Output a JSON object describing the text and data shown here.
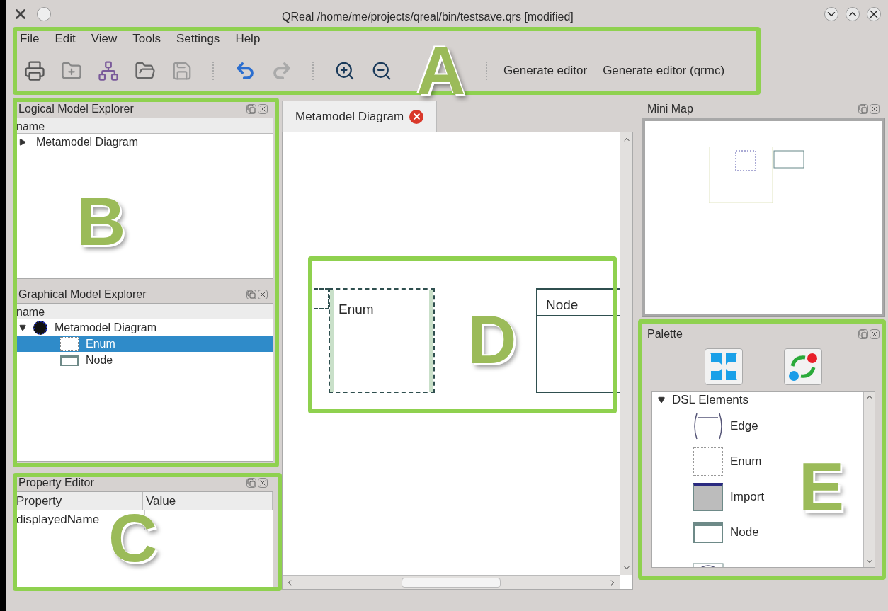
{
  "window": {
    "title": "QReal /home/me/projects/qreal/bin/testsave.qrs [modified]"
  },
  "menu": [
    "File",
    "Edit",
    "View",
    "Tools",
    "Settings",
    "Help"
  ],
  "toolbar": {
    "icons": [
      {
        "kind": "print"
      },
      {
        "kind": "new-folder"
      },
      {
        "kind": "diagram"
      },
      {
        "kind": "open"
      },
      {
        "kind": "save"
      },
      {
        "kind": "sep"
      },
      {
        "kind": "undo"
      },
      {
        "kind": "redo"
      },
      {
        "kind": "sep"
      },
      {
        "kind": "zoom-in"
      },
      {
        "kind": "zoom-out"
      }
    ],
    "actions": [
      "Generate editor",
      "Generate editor (qrmc)"
    ]
  },
  "logical_explorer": {
    "title": "Logical Model Explorer",
    "header": "name",
    "items": [
      {
        "label": "Metamodel Diagram",
        "expanded": false,
        "selected": false
      }
    ]
  },
  "graphical_explorer": {
    "title": "Graphical Model Explorer",
    "header": "name",
    "items": [
      {
        "label": "Metamodel Diagram",
        "expanded": true,
        "selected": false,
        "kind": "diagram",
        "children": [
          {
            "label": "Enum",
            "selected": true,
            "kind": "enum"
          },
          {
            "label": "Node",
            "selected": false,
            "kind": "node"
          }
        ]
      }
    ]
  },
  "property_editor": {
    "title": "Property Editor",
    "columns": [
      "Property",
      "Value"
    ],
    "rows": [
      {
        "property": "displayedName"
      }
    ]
  },
  "tabs": [
    {
      "label": "Metamodel Diagram",
      "selected": true
    }
  ],
  "canvas": {
    "nodes": [
      {
        "kind": "enum",
        "label": "Enum",
        "selected": true
      },
      {
        "kind": "node",
        "label": "Node",
        "selected": false
      }
    ]
  },
  "mini_map": {
    "title": "Mini Map"
  },
  "palette": {
    "title": "Palette",
    "group": {
      "label": "DSL Elements",
      "expanded": true,
      "items": [
        {
          "kind": "edge",
          "label": "Edge"
        },
        {
          "kind": "enum",
          "label": "Enum"
        },
        {
          "kind": "import",
          "label": "Import"
        },
        {
          "kind": "node",
          "label": "Node"
        },
        {
          "kind": "port"
        }
      ]
    }
  },
  "annotations": [
    {
      "letter": "A"
    },
    {
      "letter": "B"
    },
    {
      "letter": "C"
    },
    {
      "letter": "D"
    },
    {
      "letter": "E"
    }
  ]
}
